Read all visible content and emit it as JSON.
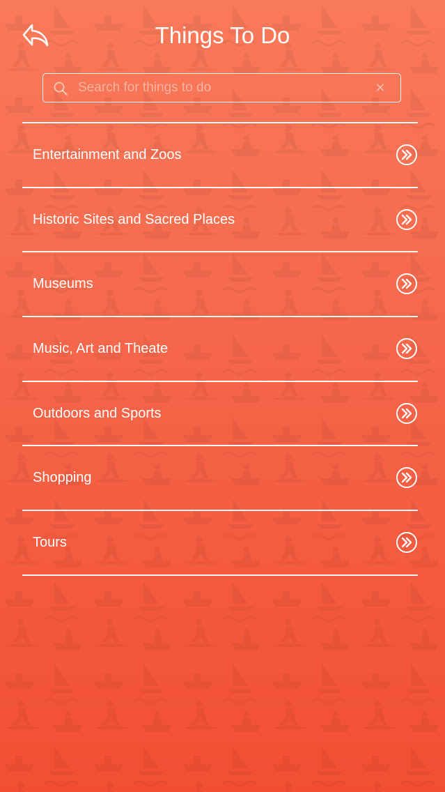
{
  "header": {
    "title": "Things To Do",
    "back_icon": "back-arrow-icon"
  },
  "search": {
    "placeholder": "Search for things to do",
    "value": "",
    "search_icon": "search-icon",
    "clear_icon": "clear-icon",
    "clear_glyph": "✕"
  },
  "list": {
    "items": [
      {
        "label": "Entertainment and Zoos",
        "icon": "double-chevron-right-icon"
      },
      {
        "label": "Historic Sites and Sacred Places",
        "icon": "double-chevron-right-icon"
      },
      {
        "label": "Museums",
        "icon": "double-chevron-right-icon"
      },
      {
        "label": "Music, Art and Theate",
        "icon": "double-chevron-right-icon"
      },
      {
        "label": "Outdoors and Sports",
        "icon": "double-chevron-right-icon"
      },
      {
        "label": "Shopping",
        "icon": "double-chevron-right-icon"
      },
      {
        "label": "Tours",
        "icon": "double-chevron-right-icon"
      }
    ]
  },
  "colors": {
    "background_top": "#f97a5a",
    "background_bottom": "#f24f32",
    "foreground": "#ffffff"
  }
}
